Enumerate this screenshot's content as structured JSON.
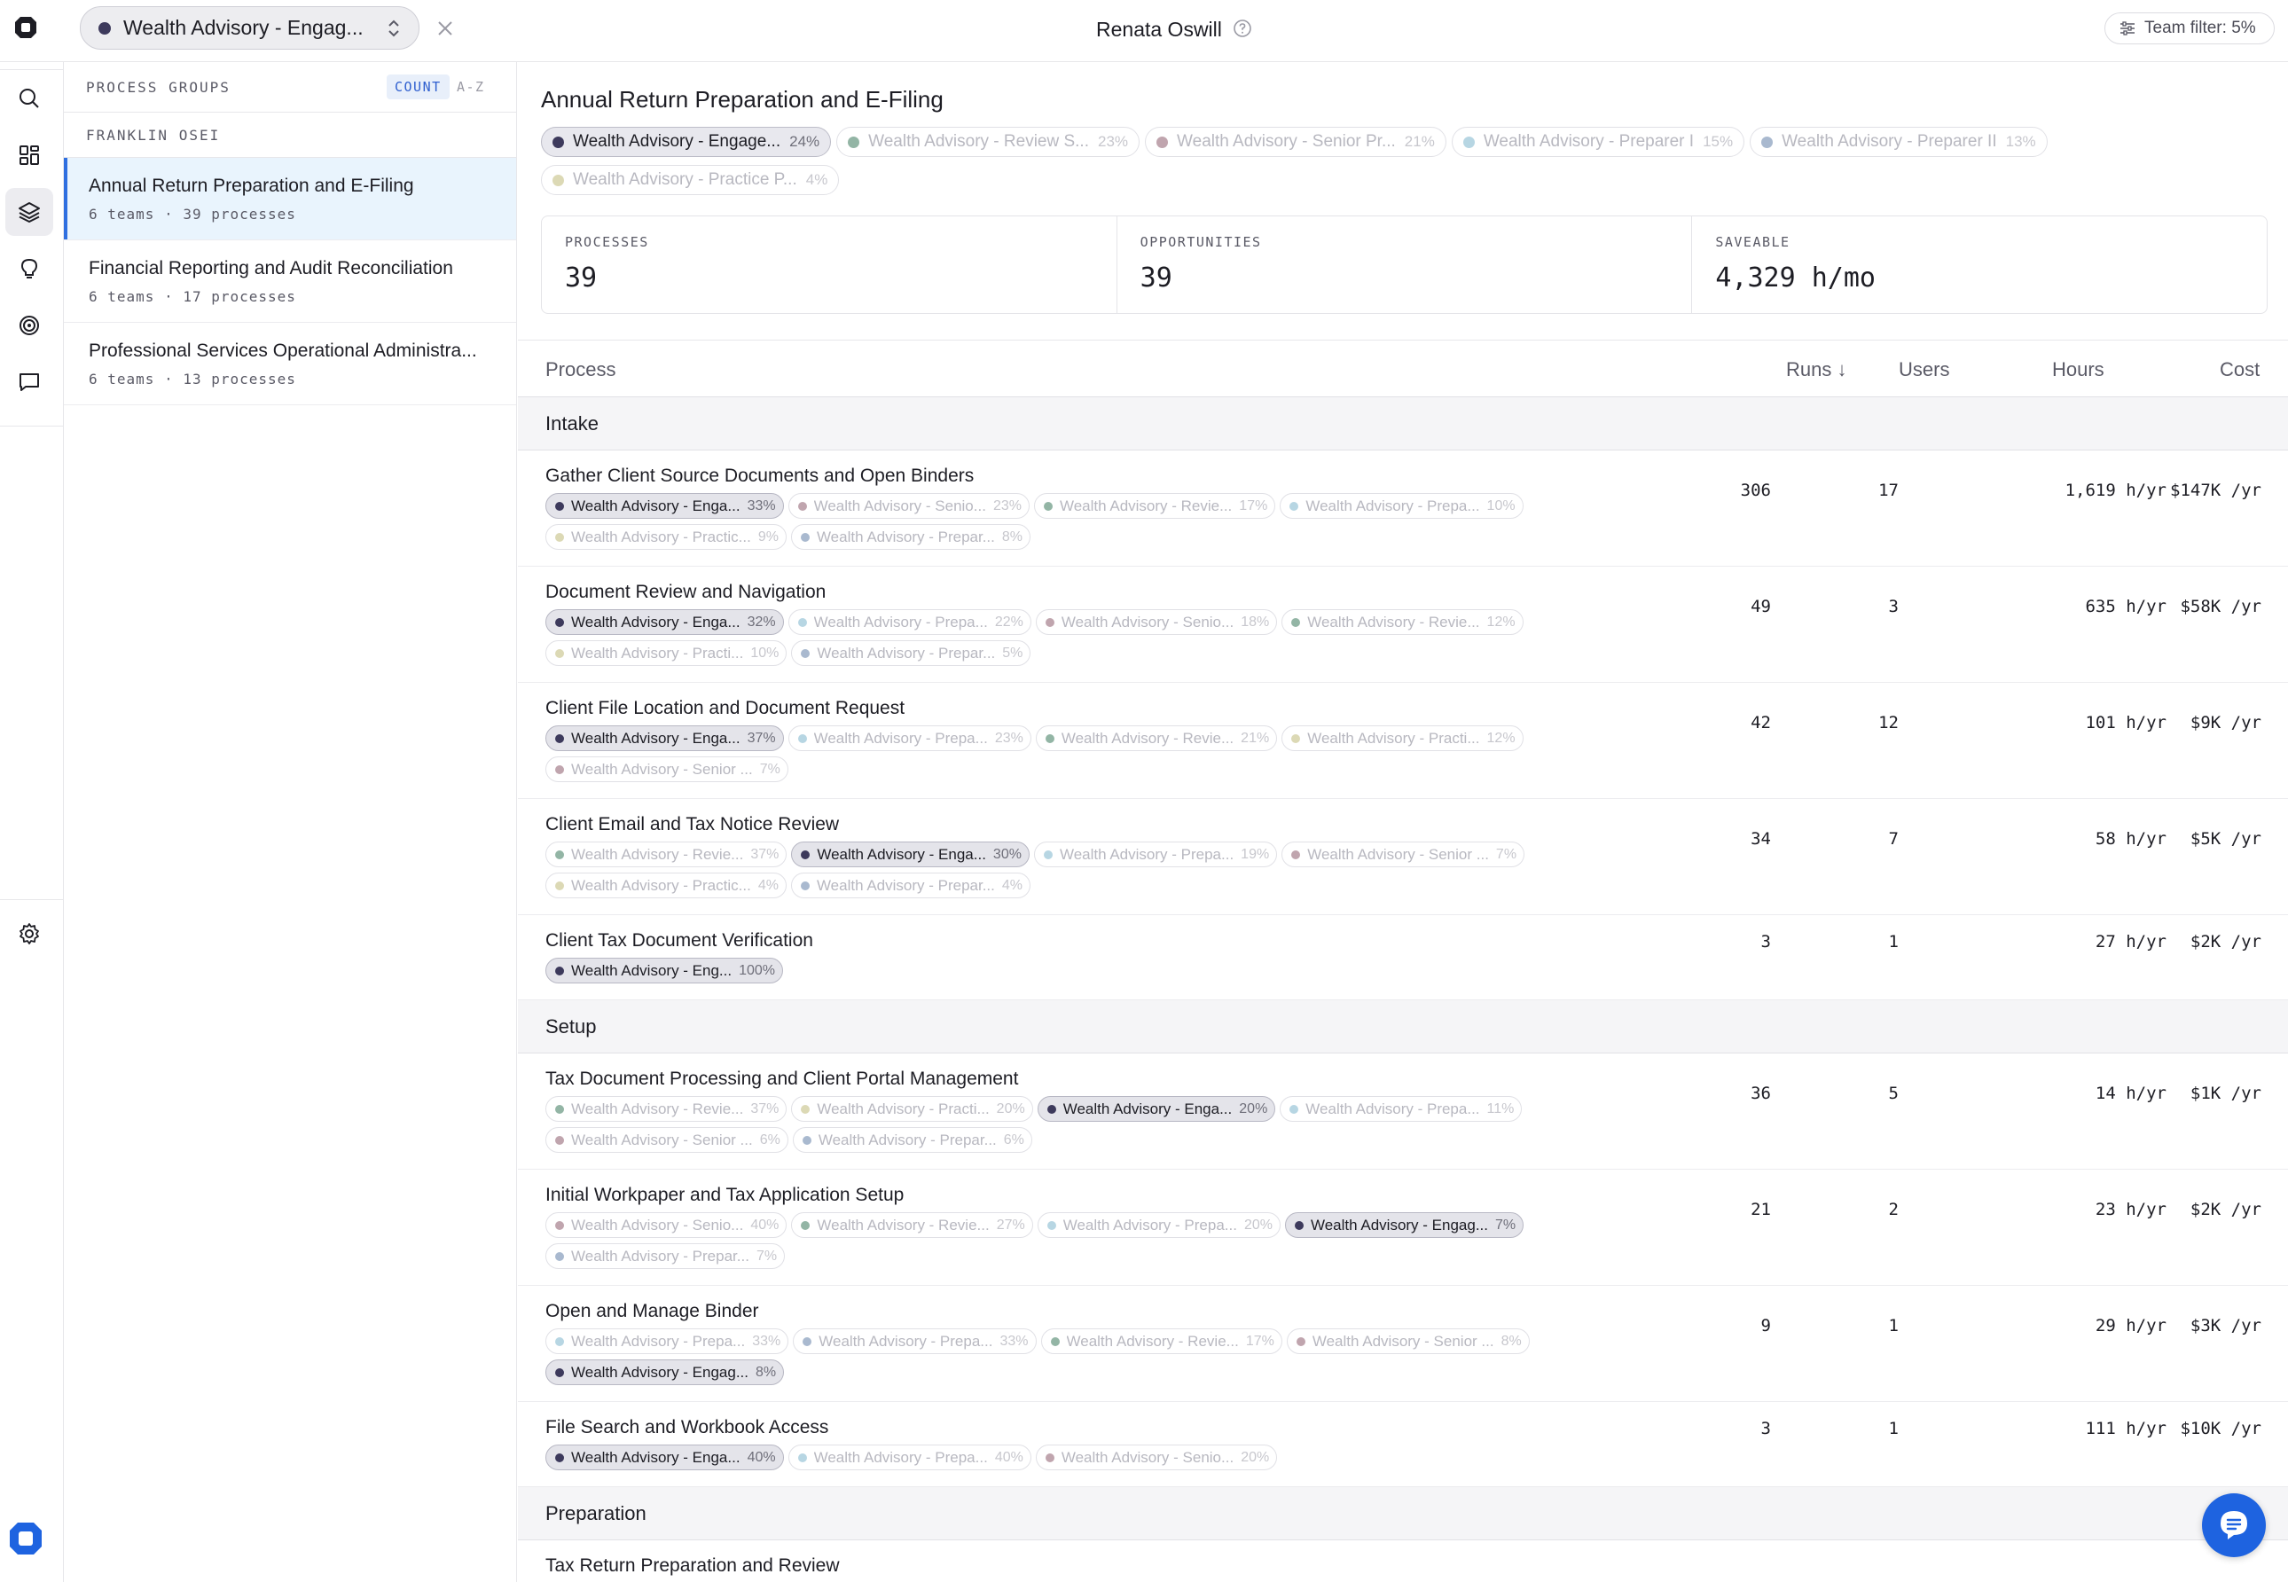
{
  "topbar": {
    "team_select": "Wealth Advisory - Engag...",
    "user_name": "Renata Oswill",
    "team_filter": "Team filter: 5%"
  },
  "sidebar": {
    "title": "PROCESS GROUPS",
    "sort_count": "COUNT",
    "sort_az": "A-Z",
    "owner": "FRANKLIN OSEI",
    "groups": [
      {
        "name": "Annual Return Preparation and E-Filing",
        "meta": "6 teams · 39 processes"
      },
      {
        "name": "Financial Reporting and Audit Reconciliation",
        "meta": "6 teams · 17 processes"
      },
      {
        "name": "Professional Services Operational Administra...",
        "meta": "6 teams · 13 processes"
      }
    ]
  },
  "main": {
    "title": "Annual Return Preparation and E-Filing",
    "team_chips": [
      {
        "name": "Wealth Advisory - Engage...",
        "pct": "24%",
        "color": "#3d3a5c",
        "selected": true
      },
      {
        "name": "Wealth Advisory - Review S...",
        "pct": "23%",
        "color": "#93b5a5",
        "selected": false
      },
      {
        "name": "Wealth Advisory - Senior Pr...",
        "pct": "21%",
        "color": "#c0a5ae",
        "selected": false
      },
      {
        "name": "Wealth Advisory - Preparer I",
        "pct": "15%",
        "color": "#b7d6e3",
        "selected": false
      },
      {
        "name": "Wealth Advisory - Preparer II",
        "pct": "13%",
        "color": "#a9b9cf",
        "selected": false
      },
      {
        "name": "Wealth Advisory - Practice P...",
        "pct": "4%",
        "color": "#dcd9b5",
        "selected": false
      }
    ],
    "stats": [
      {
        "label": "PROCESSES",
        "value": "39"
      },
      {
        "label": "OPPORTUNITIES",
        "value": "39"
      },
      {
        "label": "SAVEABLE",
        "value": "4,329 h/mo"
      }
    ],
    "columns": {
      "process": "Process",
      "runs": "Runs ↓",
      "users": "Users",
      "hours": "Hours",
      "cost": "Cost"
    }
  },
  "sections": [
    {
      "name": "Intake",
      "rows": [
        {
          "name": "Gather Client Source Documents and Open Binders",
          "runs": "306",
          "users": "17",
          "hours": "1,619 h/yr",
          "cost": "$147K /yr",
          "chips": [
            {
              "name": "Wealth Advisory - Enga...",
              "pct": "33%",
              "color": "#3d3a5c",
              "sel": true
            },
            {
              "name": "Wealth Advisory - Senio...",
              "pct": "23%",
              "color": "#c0a5ae",
              "sel": false
            },
            {
              "name": "Wealth Advisory - Revie...",
              "pct": "17%",
              "color": "#93b5a5",
              "sel": false
            },
            {
              "name": "Wealth Advisory - Prepa...",
              "pct": "10%",
              "color": "#b7d6e3",
              "sel": false
            },
            {
              "name": "Wealth Advisory - Practic...",
              "pct": "9%",
              "color": "#dcd9b5",
              "sel": false
            },
            {
              "name": "Wealth Advisory - Prepar...",
              "pct": "8%",
              "color": "#a9b9cf",
              "sel": false
            }
          ]
        },
        {
          "name": "Document Review and Navigation",
          "runs": "49",
          "users": "3",
          "hours": "635 h/yr",
          "cost": "$58K /yr",
          "chips": [
            {
              "name": "Wealth Advisory - Enga...",
              "pct": "32%",
              "color": "#3d3a5c",
              "sel": true
            },
            {
              "name": "Wealth Advisory - Prepa...",
              "pct": "22%",
              "color": "#b7d6e3",
              "sel": false
            },
            {
              "name": "Wealth Advisory - Senio...",
              "pct": "18%",
              "color": "#c0a5ae",
              "sel": false
            },
            {
              "name": "Wealth Advisory - Revie...",
              "pct": "12%",
              "color": "#93b5a5",
              "sel": false
            },
            {
              "name": "Wealth Advisory - Practi...",
              "pct": "10%",
              "color": "#dcd9b5",
              "sel": false
            },
            {
              "name": "Wealth Advisory - Prepar...",
              "pct": "5%",
              "color": "#a9b9cf",
              "sel": false
            }
          ]
        },
        {
          "name": "Client File Location and Document Request",
          "runs": "42",
          "users": "12",
          "hours": "101 h/yr",
          "cost": "$9K /yr",
          "chips": [
            {
              "name": "Wealth Advisory - Enga...",
              "pct": "37%",
              "color": "#3d3a5c",
              "sel": true
            },
            {
              "name": "Wealth Advisory - Prepa...",
              "pct": "23%",
              "color": "#b7d6e3",
              "sel": false
            },
            {
              "name": "Wealth Advisory - Revie...",
              "pct": "21%",
              "color": "#93b5a5",
              "sel": false
            },
            {
              "name": "Wealth Advisory - Practi...",
              "pct": "12%",
              "color": "#dcd9b5",
              "sel": false
            },
            {
              "name": "Wealth Advisory - Senior ...",
              "pct": "7%",
              "color": "#c0a5ae",
              "sel": false
            }
          ]
        },
        {
          "name": "Client Email and Tax Notice Review",
          "runs": "34",
          "users": "7",
          "hours": "58 h/yr",
          "cost": "$5K /yr",
          "chips": [
            {
              "name": "Wealth Advisory - Revie...",
              "pct": "37%",
              "color": "#93b5a5",
              "sel": false
            },
            {
              "name": "Wealth Advisory - Enga...",
              "pct": "30%",
              "color": "#3d3a5c",
              "sel": true
            },
            {
              "name": "Wealth Advisory - Prepa...",
              "pct": "19%",
              "color": "#b7d6e3",
              "sel": false
            },
            {
              "name": "Wealth Advisory - Senior ...",
              "pct": "7%",
              "color": "#c0a5ae",
              "sel": false
            },
            {
              "name": "Wealth Advisory - Practic...",
              "pct": "4%",
              "color": "#dcd9b5",
              "sel": false
            },
            {
              "name": "Wealth Advisory - Prepar...",
              "pct": "4%",
              "color": "#a9b9cf",
              "sel": false
            }
          ]
        },
        {
          "name": "Client Tax Document Verification",
          "runs": "3",
          "users": "1",
          "hours": "27 h/yr",
          "cost": "$2K /yr",
          "chips": [
            {
              "name": "Wealth Advisory - Eng...",
              "pct": "100%",
              "color": "#3d3a5c",
              "sel": true
            }
          ]
        }
      ]
    },
    {
      "name": "Setup",
      "rows": [
        {
          "name": "Tax Document Processing and Client Portal Management",
          "runs": "36",
          "users": "5",
          "hours": "14 h/yr",
          "cost": "$1K /yr",
          "chips": [
            {
              "name": "Wealth Advisory - Revie...",
              "pct": "37%",
              "color": "#93b5a5",
              "sel": false
            },
            {
              "name": "Wealth Advisory - Practi...",
              "pct": "20%",
              "color": "#dcd9b5",
              "sel": false
            },
            {
              "name": "Wealth Advisory - Enga...",
              "pct": "20%",
              "color": "#3d3a5c",
              "sel": true
            },
            {
              "name": "Wealth Advisory - Prepa...",
              "pct": "11%",
              "color": "#b7d6e3",
              "sel": false
            },
            {
              "name": "Wealth Advisory - Senior ...",
              "pct": "6%",
              "color": "#c0a5ae",
              "sel": false
            },
            {
              "name": "Wealth Advisory - Prepar...",
              "pct": "6%",
              "color": "#a9b9cf",
              "sel": false
            }
          ]
        },
        {
          "name": "Initial Workpaper and Tax Application Setup",
          "runs": "21",
          "users": "2",
          "hours": "23 h/yr",
          "cost": "$2K /yr",
          "chips": [
            {
              "name": "Wealth Advisory - Senio...",
              "pct": "40%",
              "color": "#c0a5ae",
              "sel": false
            },
            {
              "name": "Wealth Advisory - Revie...",
              "pct": "27%",
              "color": "#93b5a5",
              "sel": false
            },
            {
              "name": "Wealth Advisory - Prepa...",
              "pct": "20%",
              "color": "#b7d6e3",
              "sel": false
            },
            {
              "name": "Wealth Advisory - Engag...",
              "pct": "7%",
              "color": "#3d3a5c",
              "sel": true
            },
            {
              "name": "Wealth Advisory - Prepar...",
              "pct": "7%",
              "color": "#a9b9cf",
              "sel": false
            }
          ]
        },
        {
          "name": "Open and Manage Binder",
          "runs": "9",
          "users": "1",
          "hours": "29 h/yr",
          "cost": "$3K /yr",
          "chips": [
            {
              "name": "Wealth Advisory - Prepa...",
              "pct": "33%",
              "color": "#b7d6e3",
              "sel": false
            },
            {
              "name": "Wealth Advisory - Prepa...",
              "pct": "33%",
              "color": "#a9b9cf",
              "sel": false
            },
            {
              "name": "Wealth Advisory - Revie...",
              "pct": "17%",
              "color": "#93b5a5",
              "sel": false
            },
            {
              "name": "Wealth Advisory - Senior ...",
              "pct": "8%",
              "color": "#c0a5ae",
              "sel": false
            },
            {
              "name": "Wealth Advisory - Engag...",
              "pct": "8%",
              "color": "#3d3a5c",
              "sel": true
            }
          ]
        },
        {
          "name": "File Search and Workbook Access",
          "runs": "3",
          "users": "1",
          "hours": "111 h/yr",
          "cost": "$10K /yr",
          "chips": [
            {
              "name": "Wealth Advisory - Enga...",
              "pct": "40%",
              "color": "#3d3a5c",
              "sel": true
            },
            {
              "name": "Wealth Advisory - Prepa...",
              "pct": "40%",
              "color": "#b7d6e3",
              "sel": false
            },
            {
              "name": "Wealth Advisory - Senio...",
              "pct": "20%",
              "color": "#c0a5ae",
              "sel": false
            }
          ]
        }
      ]
    },
    {
      "name": "Preparation",
      "rows": [
        {
          "name": "Tax Return Preparation and Review",
          "runs": "",
          "users": "",
          "hours": "",
          "cost": "",
          "chips": []
        }
      ]
    }
  ]
}
